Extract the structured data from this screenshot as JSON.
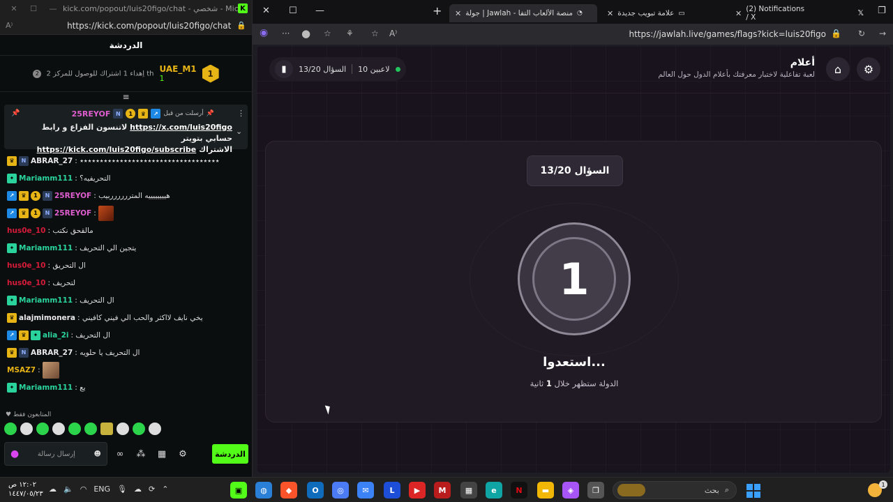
{
  "left_window": {
    "title": "kick.com/popout/luis20figo/chat - شخصي - Micro...",
    "url": "https://kick.com/popout/luis20figo/chat",
    "chat_header": "الدردشة",
    "leader": {
      "rank": "1",
      "username": "UAE_M1",
      "count": "1",
      "position_badge": "2",
      "message": "اِهداء 1 اشتراك للوصول للمركز 2 th"
    },
    "pinned": {
      "label": "أرسلت من قبل",
      "username": "25REYOF",
      "text_prefix": "لاتنسون الفزاع و رابط",
      "link1": "https://x.com/luis20figo",
      "text_mid": "حسابي بتويتر",
      "link2": "https://kick.com/luis20figo/subscribe",
      "text_suffix": "الاشتراك"
    },
    "messages": [
      {
        "badges": [
          "crown",
          "n"
        ],
        "user": "ABRAR_27",
        "color": "#e8e8e8",
        "text": ": ٭٭٭٭٭٭٭٭٭٭٭٭٭٭٭٭٭٭٭٭٭٭٭٭٭٭٭٭٭٭٭٭٭٭٭"
      },
      {
        "badges": [
          "gift"
        ],
        "user": "Mariamm111",
        "color": "#2ad39b",
        "text": ": التحريفيه؟"
      },
      {
        "badges": [
          "blue",
          "crown",
          "gold",
          "n"
        ],
        "user": "25REYOF",
        "color": "#e05ed0",
        "text": ": هييييييييه المترررررربيب"
      },
      {
        "badges": [
          "blue",
          "crown",
          "gold",
          "n"
        ],
        "user": "25REYOF",
        "color": "#e05ed0",
        "text": ":",
        "image": true
      },
      {
        "badges": [],
        "user": "hus0e_10",
        "color": "#d61b3a",
        "text": ": مالقحق نكتب"
      },
      {
        "badges": [
          "gift"
        ],
        "user": "Mariamm111",
        "color": "#2ad39b",
        "text": ": يتجين الي التحريف"
      },
      {
        "badges": [],
        "user": "hus0e_10",
        "color": "#d61b3a",
        "text": ": ال التحريق"
      },
      {
        "badges": [],
        "user": "hus0e_10",
        "color": "#d61b3a",
        "text": ": لتحريف"
      },
      {
        "badges": [
          "gift"
        ],
        "user": "Mariamm111",
        "color": "#2ad39b",
        "text": ": ال التحريف"
      },
      {
        "badges": [
          "crown"
        ],
        "user": "alajmimonera",
        "color": "#e8e8e8",
        "text": ": يخي نايف لااكثر والحب الي فيني كافيني"
      },
      {
        "badges": [
          "blue",
          "crown",
          "gift"
        ],
        "user": "alia_2i",
        "color": "#2ad39b",
        "text": ": ال التحريف"
      },
      {
        "badges": [
          "crown",
          "n"
        ],
        "user": "ABRAR_27",
        "color": "#e8e8e8",
        "text": ": ال التحريف يا حلويه"
      },
      {
        "badges": [],
        "user": "MSAZ7",
        "color": "#e7b416",
        "text": ":",
        "image2": true
      },
      {
        "badges": [
          "gift"
        ],
        "user": "Mariamm111",
        "color": "#2ad39b",
        "text": ": يع"
      }
    ],
    "followers_only": "المتابعون فقط",
    "input_placeholder": "إرسال رسالة",
    "send_button": "الدردشة"
  },
  "right_window": {
    "tabs": [
      {
        "label": "(2) Notifications / X"
      },
      {
        "label": "علامة تبويب جديدة"
      },
      {
        "label": "جولة | Jawlah - منصة الألعاب التفا",
        "active": true
      }
    ],
    "url": "https://jawlah.live/games/flags?kick=luis20figo",
    "game": {
      "title": "أعلام",
      "subtitle": "لعبة تفاعلية لاختبار معرفتك بأعلام الدول حول العالم",
      "players": "10 لاعبين",
      "question_status": "السؤال 13/20",
      "question_pill": "السؤال 13/20",
      "countdown": "1",
      "ready_text": "استعدوا...",
      "ready_sub_prefix": "الدولة ستظهر خلال",
      "ready_sub_num": "1",
      "ready_sub_suffix": "ثانية"
    }
  },
  "taskbar": {
    "time": "١٢:٠٢ ص",
    "date": "١٤٤٧/٠٥/٢٣",
    "lang": "ENG",
    "search_placeholder": "بحث"
  },
  "colors": {
    "kick_green": "#53fc18",
    "accent_gold": "#e7b416",
    "online_dot": "#22c55e"
  }
}
